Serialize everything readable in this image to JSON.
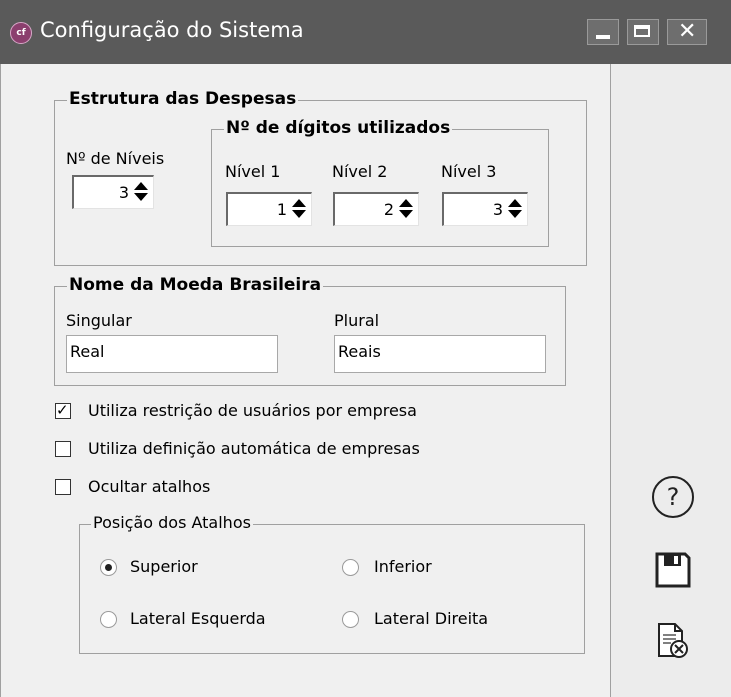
{
  "window": {
    "app_icon": "cf-logo-icon",
    "app_icon_text": "cf",
    "title": "Configuração do Sistema",
    "controls": [
      "minimize-icon",
      "maximize-icon",
      "close-icon"
    ]
  },
  "expenses": {
    "title": "Estrutura das Despesas",
    "levels_label": "Nº de Níveis",
    "levels_value": "3",
    "digits": {
      "title": "Nº de dígitos utilizados",
      "levels": [
        {
          "label": "Nível 1",
          "value": "1"
        },
        {
          "label": "Nível 2",
          "value": "2"
        },
        {
          "label": "Nível 3",
          "value": "3"
        }
      ]
    }
  },
  "currency": {
    "title": "Nome da Moeda Brasileira",
    "singular_label": "Singular",
    "singular_value": "Real",
    "plural_label": "Plural",
    "plural_value": "Reais"
  },
  "options": [
    {
      "label": "Utiliza restrição de usuários por empresa",
      "checked": true
    },
    {
      "label": "Utiliza definição automática de empresas",
      "checked": false
    },
    {
      "label": "Ocultar atalhos",
      "checked": false
    }
  ],
  "shortcuts": {
    "title": "Posição dos Atalhos",
    "positions": [
      {
        "label": "Superior",
        "selected": true
      },
      {
        "label": "Inferior",
        "selected": false
      },
      {
        "label": "Lateral Esquerda",
        "selected": false
      },
      {
        "label": "Lateral Direita",
        "selected": false
      }
    ]
  },
  "side_actions": [
    "help-icon",
    "save-icon",
    "cancel-document-icon"
  ],
  "colors": {
    "titlebar": "#5a5a5a",
    "background": "#f0f0f0",
    "app_icon": "#8b3f6e"
  }
}
